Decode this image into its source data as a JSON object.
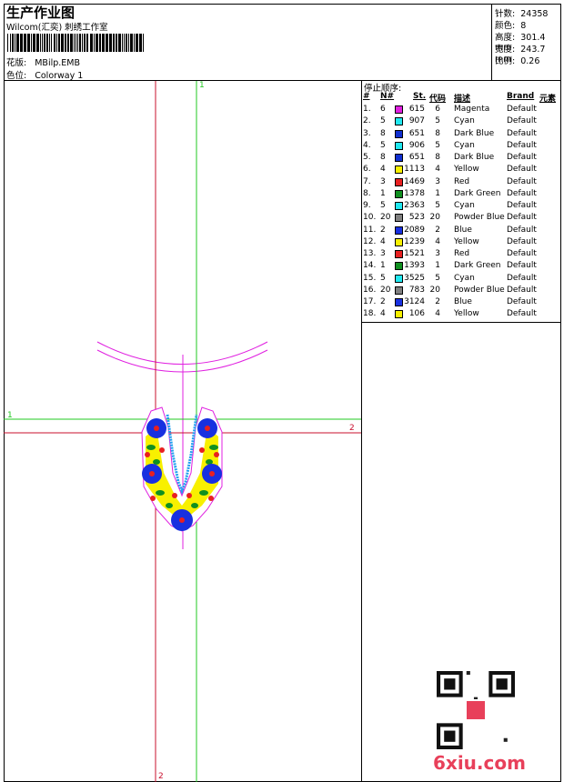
{
  "header": {
    "title": "生产作业图",
    "subtitle": "Wilcom(汇奕) 刺绣工作室",
    "design_label": "花版:",
    "design_value": "MBilp.EMB",
    "colorway_label": "色位:",
    "colorway_value": "Colorway 1"
  },
  "stats": [
    {
      "label": "针数:",
      "value": "24358"
    },
    {
      "label": "颜色:",
      "value": "8"
    },
    {
      "label": "高度:",
      "value": "301.4 mm"
    },
    {
      "label": "宽度:",
      "value": "243.7 mm"
    },
    {
      "label": "比例:",
      "value": "0.26"
    }
  ],
  "stop_sequence": {
    "title": "停止顺序:",
    "headers": {
      "index": "#",
      "needle": "N#",
      "stitches": "St.",
      "code": "代码",
      "description": "描述",
      "brand": "Brand",
      "element": "元素"
    },
    "rows": [
      {
        "index": "1.",
        "needle": "6",
        "color": "#e020e0",
        "stitches": "615",
        "code": "6",
        "description": "Magenta",
        "brand": "Default"
      },
      {
        "index": "2.",
        "needle": "5",
        "color": "#20e8f0",
        "stitches": "907",
        "code": "5",
        "description": "Cyan",
        "brand": "Default"
      },
      {
        "index": "3.",
        "needle": "8",
        "color": "#1030d0",
        "stitches": "651",
        "code": "8",
        "description": "Dark Blue",
        "brand": "Default"
      },
      {
        "index": "4.",
        "needle": "5",
        "color": "#20e8f0",
        "stitches": "906",
        "code": "5",
        "description": "Cyan",
        "brand": "Default"
      },
      {
        "index": "5.",
        "needle": "8",
        "color": "#1030d0",
        "stitches": "651",
        "code": "8",
        "description": "Dark Blue",
        "brand": "Default"
      },
      {
        "index": "6.",
        "needle": "4",
        "color": "#f8f000",
        "stitches": "1113",
        "code": "4",
        "description": "Yellow",
        "brand": "Default"
      },
      {
        "index": "7.",
        "needle": "3",
        "color": "#e82020",
        "stitches": "1469",
        "code": "3",
        "description": "Red",
        "brand": "Default"
      },
      {
        "index": "8.",
        "needle": "1",
        "color": "#109020",
        "stitches": "1378",
        "code": "1",
        "description": "Dark Green",
        "brand": "Default"
      },
      {
        "index": "9.",
        "needle": "5",
        "color": "#20e8f0",
        "stitches": "2363",
        "code": "5",
        "description": "Cyan",
        "brand": "Default"
      },
      {
        "index": "10.",
        "needle": "20",
        "color": "#808080",
        "stitches": "523",
        "code": "20",
        "description": "Powder Blue",
        "brand": "Default"
      },
      {
        "index": "11.",
        "needle": "2",
        "color": "#1830e0",
        "stitches": "2089",
        "code": "2",
        "description": "Blue",
        "brand": "Default"
      },
      {
        "index": "12.",
        "needle": "4",
        "color": "#f8f000",
        "stitches": "1239",
        "code": "4",
        "description": "Yellow",
        "brand": "Default"
      },
      {
        "index": "13.",
        "needle": "3",
        "color": "#e82020",
        "stitches": "1521",
        "code": "3",
        "description": "Red",
        "brand": "Default"
      },
      {
        "index": "14.",
        "needle": "1",
        "color": "#109020",
        "stitches": "1393",
        "code": "1",
        "description": "Dark Green",
        "brand": "Default"
      },
      {
        "index": "15.",
        "needle": "5",
        "color": "#20e8f0",
        "stitches": "3525",
        "code": "5",
        "description": "Cyan",
        "brand": "Default"
      },
      {
        "index": "16.",
        "needle": "20",
        "color": "#808080",
        "stitches": "783",
        "code": "20",
        "description": "Powder Blue",
        "brand": "Default"
      },
      {
        "index": "17.",
        "needle": "2",
        "color": "#1830e0",
        "stitches": "3124",
        "code": "2",
        "description": "Blue",
        "brand": "Default"
      },
      {
        "index": "18.",
        "needle": "4",
        "color": "#f8f000",
        "stitches": "106",
        "code": "4",
        "description": "Yellow",
        "brand": "Default"
      }
    ]
  },
  "guides": {
    "green_top_label": "1",
    "green_left_label": "1",
    "red_right_label": "2",
    "red_bottom_label": "2",
    "green_color": "#20c820",
    "red_color": "#c8102e",
    "magenta_color": "#e020e0"
  },
  "watermark": {
    "text": "6xiu.com",
    "icon": "qr-code-icon"
  }
}
